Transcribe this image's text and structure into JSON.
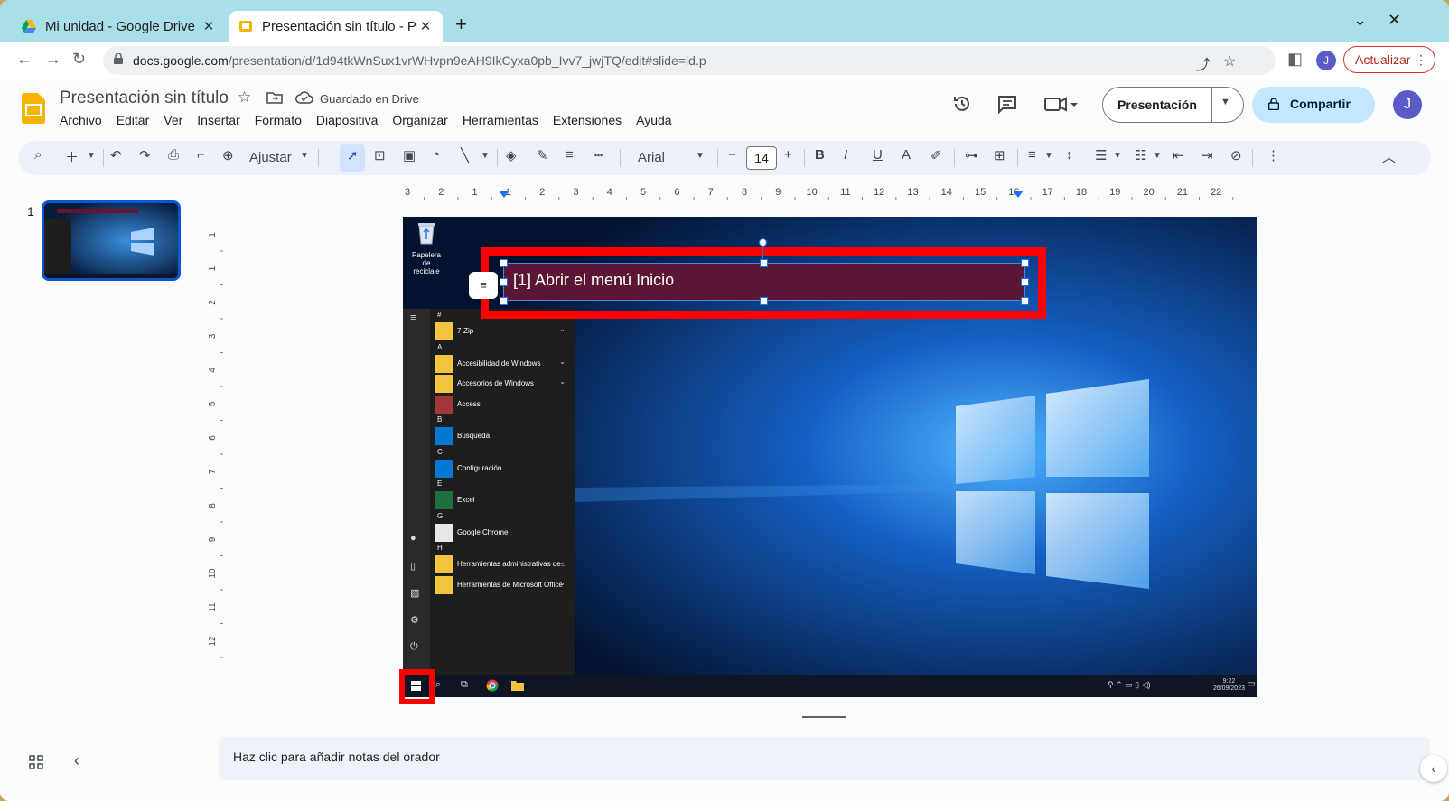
{
  "browser": {
    "tabs": [
      {
        "title": "Mi unidad - Google Drive",
        "active": false
      },
      {
        "title": "Presentación sin título - Presentaciones de Google",
        "active": true
      }
    ],
    "new_tab_symbol": "+",
    "window_controls": {
      "dropdown": "⌄",
      "close": "✕"
    },
    "url_host": "docs.google.com",
    "url_path": "/presentation/d/1d94tkWnSux1vrWHvpn9eAH9IkCyxa0pb_Ivv7_jwjTQ/edit#slide=id.p",
    "profile_initial": "J",
    "update_label": "Actualizar",
    "update_menu": "⋮"
  },
  "app": {
    "doc_title": "Presentación sin título",
    "saved_status": "Guardado en Drive",
    "menu": [
      "Archivo",
      "Editar",
      "Ver",
      "Insertar",
      "Formato",
      "Diapositiva",
      "Organizar",
      "Herramientas",
      "Extensiones",
      "Ayuda"
    ],
    "present_label": "Presentación",
    "share_label": "Compartir",
    "avatar_initial": "J",
    "accent_color": "#0b57d0",
    "share_bg": "#c2e7ff"
  },
  "toolbar": {
    "zoom_label": "Ajustar",
    "font_family": "Arial",
    "font_size": "14",
    "minus": "−",
    "plus": "+",
    "bold": "B",
    "italic": "I",
    "underline": "U",
    "text_color": "A"
  },
  "filmstrip": {
    "slide_number": "1"
  },
  "rulers": {
    "horizontal": [
      "3",
      "2",
      "1",
      "1",
      "2",
      "3",
      "4",
      "5",
      "6",
      "7",
      "8",
      "9",
      "10",
      "11",
      "12",
      "13",
      "14",
      "15",
      "16",
      "17",
      "18",
      "19",
      "20",
      "21",
      "22"
    ],
    "vertical": [
      "1",
      "1",
      "2",
      "3",
      "4",
      "5",
      "6",
      "7",
      "8",
      "9",
      "10",
      "11",
      "12"
    ]
  },
  "slide": {
    "textbox_text": "[1] Abrir el menú Inicio",
    "textbox_fill": "#5a1634",
    "highlight_color": "#ff0000",
    "desktop": {
      "recycle_bin_label": "Papelera de reciclaje",
      "start_menu": [
        {
          "type": "letter",
          "text": "#"
        },
        {
          "type": "item",
          "text": "7-Zip",
          "color": "#f3c43e",
          "chevron": true
        },
        {
          "type": "letter",
          "text": "A"
        },
        {
          "type": "item",
          "text": "Accesibilidad de Windows",
          "color": "#f3c43e",
          "chevron": true
        },
        {
          "type": "item",
          "text": "Accesorios de Windows",
          "color": "#f3c43e",
          "chevron": true
        },
        {
          "type": "item",
          "text": "Access",
          "color": "#a4373a",
          "chevron": false
        },
        {
          "type": "letter",
          "text": "B"
        },
        {
          "type": "item",
          "text": "Búsqueda",
          "color": "#0078d4",
          "chevron": false
        },
        {
          "type": "letter",
          "text": "C"
        },
        {
          "type": "item",
          "text": "Configuración",
          "color": "#0078d4",
          "chevron": false
        },
        {
          "type": "letter",
          "text": "E"
        },
        {
          "type": "item",
          "text": "Excel",
          "color": "#1d6f42",
          "chevron": false
        },
        {
          "type": "letter",
          "text": "G"
        },
        {
          "type": "item",
          "text": "Google Chrome",
          "color": "#e8e8e8",
          "chevron": false
        },
        {
          "type": "letter",
          "text": "H"
        },
        {
          "type": "item",
          "text": "Herramientas administrativas de...",
          "color": "#f3c43e",
          "chevron": true
        },
        {
          "type": "item",
          "text": "Herramientas de Microsoft Office",
          "color": "#f3c43e",
          "chevron": true
        }
      ],
      "clock_time": "9:22",
      "clock_date": "26/09/2023"
    }
  },
  "notes": {
    "placeholder": "Haz clic para añadir notas del orador"
  }
}
